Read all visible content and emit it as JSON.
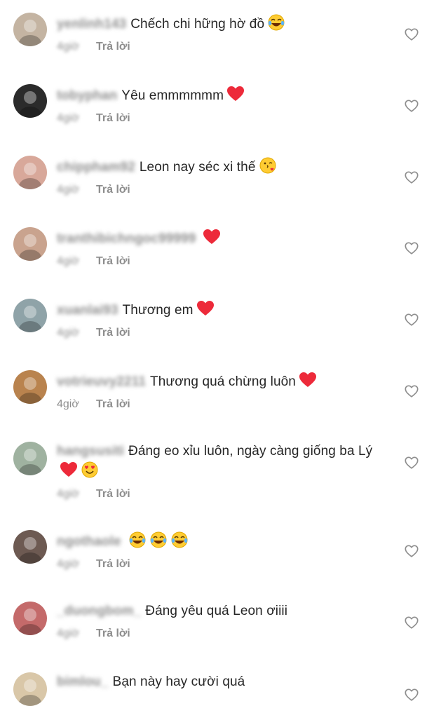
{
  "comments": [
    {
      "username": "yenlinh143",
      "text": "Chếch chi hững hờ đồ",
      "emojis": [
        "laugh-cry"
      ],
      "time": "4giờ",
      "reply": "Trả lời",
      "avatar_color": "#c4b4a2"
    },
    {
      "username": "tobyphan",
      "text": "Yêu emmmmmm",
      "emojis": [
        "red-heart"
      ],
      "time": "4giờ",
      "reply": "Trả lời",
      "avatar_color": "#2b2b2b"
    },
    {
      "username": "chippham92",
      "text": "Leon nay séc xi thế",
      "emojis": [
        "kiss-face"
      ],
      "time": "4giờ",
      "reply": "Trả lời",
      "avatar_color": "#d8a89a"
    },
    {
      "username": "tranthibichngoc99999",
      "text": "",
      "emojis": [
        "red-heart"
      ],
      "time": "4giờ",
      "reply": "Trả lời",
      "avatar_color": "#c9a38e"
    },
    {
      "username": "xuanlai93",
      "text": "Thương em",
      "emojis": [
        "red-heart"
      ],
      "time": "4giờ",
      "reply": "Trả lời",
      "avatar_color": "#8fa3a8"
    },
    {
      "username": "votrieuvy2211",
      "text": "Thương quá chừng luôn",
      "emojis": [
        "red-heart"
      ],
      "time": "4giờ",
      "reply": "Trả lời",
      "avatar_color": "#b9834e"
    },
    {
      "username": "hangsusiti",
      "text": "Đáng eo xỉu luôn, ngày càng giống ba Lý",
      "emojis": [
        "red-heart",
        "heart-eyes"
      ],
      "time": "4giờ",
      "reply": "Trả lời",
      "avatar_color": "#9fb2a0"
    },
    {
      "username": "ngothaole",
      "text": "",
      "emojis": [
        "laugh-cry",
        "laugh-cry",
        "laugh-cry"
      ],
      "time": "4giờ",
      "reply": "Trả lời",
      "avatar_color": "#6d5a52"
    },
    {
      "username": "_duongbom_",
      "text": "Đáng yêu quá Leon ơiiii",
      "emojis": [],
      "time": "4giờ",
      "reply": "Trả lời",
      "avatar_color": "#c46a6a"
    },
    {
      "username": "bimlou_",
      "text": "Bạn này hay cười quá",
      "emojis": [],
      "time": "",
      "reply": "",
      "avatar_color": "#d9c7a8"
    }
  ],
  "icons": {
    "like": "heart-outline-icon",
    "laugh-cry": "laugh-cry-emoji",
    "red-heart": "red-heart-emoji",
    "kiss-face": "kiss-emoji",
    "heart-eyes": "heart-eyes-emoji"
  },
  "colors": {
    "secondary": "#8e8e8e",
    "primary": "#262626",
    "heart": "#ed2a3a"
  }
}
